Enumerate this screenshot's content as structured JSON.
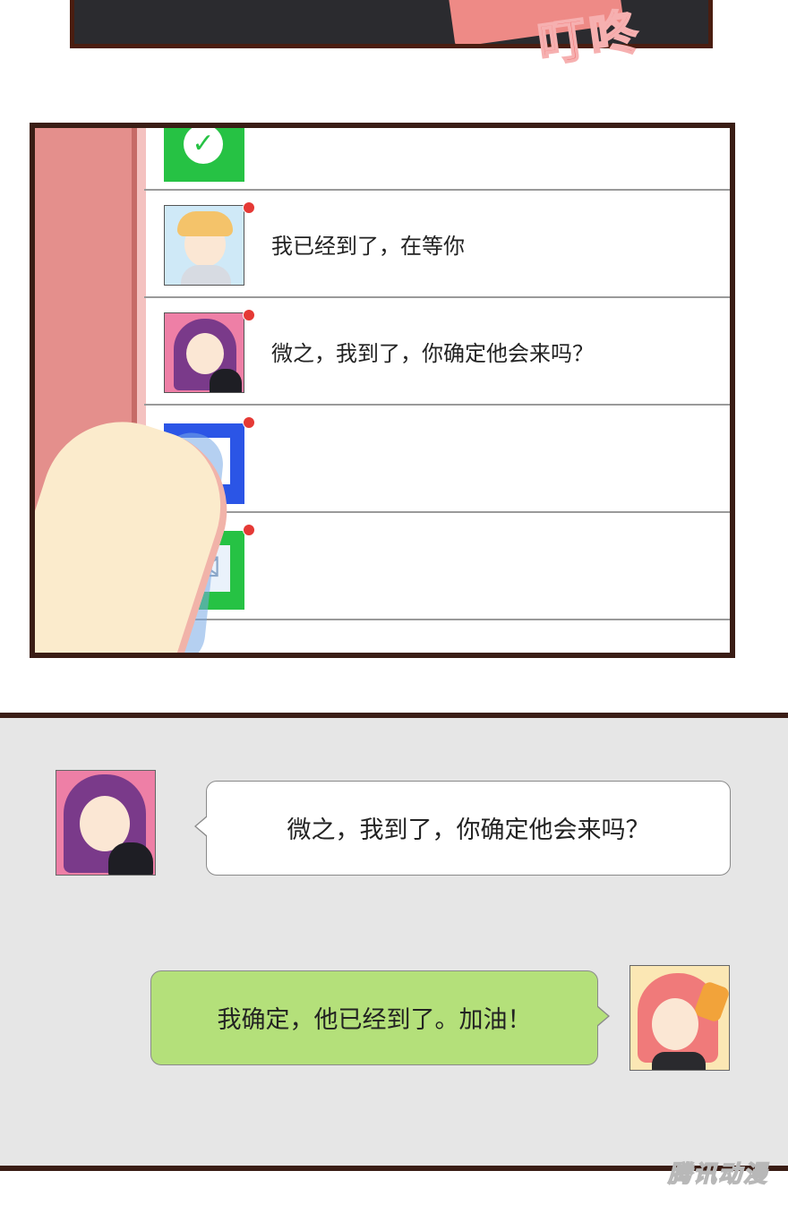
{
  "top_panel": {
    "sfx": "叮咚"
  },
  "phone": {
    "messages": [
      {
        "sender": "blond-boy",
        "text": "我已经到了，在等你"
      },
      {
        "sender": "purple-hair-girl",
        "text": "微之，我到了，你确定他会来吗？"
      }
    ]
  },
  "chat": {
    "messages": [
      {
        "sender": "purple-hair-girl",
        "text": "微之，我到了，你确定他会来吗？"
      },
      {
        "sender": "red-hair-girl",
        "text": "我确定，他已经到了。加油！"
      }
    ]
  },
  "watermark": "腾讯动漫",
  "colors": {
    "panel_border": "#3a1d15",
    "chat_bg": "#e6e6e6",
    "bubble_green": "#b4e07a",
    "notification_dot": "#e53935"
  }
}
